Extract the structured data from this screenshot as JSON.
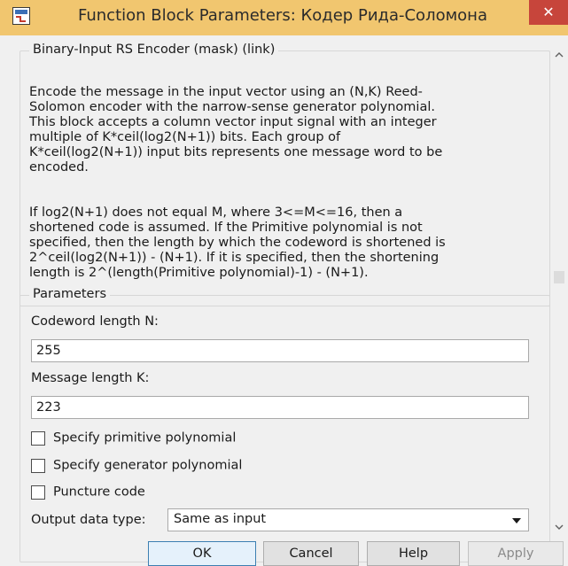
{
  "window": {
    "title": "Function Block Parameters: Кодер Рида-Соломона",
    "close_label": "✕",
    "titlebar_color": "#f1c66f",
    "close_color": "#c7453b",
    "app_icon": "simulink-block-icon"
  },
  "mask": {
    "legend": "Binary-Input RS Encoder (mask) (link)",
    "paragraphs": [
      "Encode the message in the input vector using an (N,K) Reed-\nSolomon encoder with the narrow-sense generator polynomial.\nThis block accepts a column vector input signal with an integer\nmultiple of K*ceil(log2(N+1)) bits.  Each group of\nK*ceil(log2(N+1)) input bits represents one message word to be\nencoded.",
      "If log2(N+1) does not equal M, where 3<=M<=16, then a\nshortened code is assumed.  If the Primitive polynomial is not\nspecified, then the length by which the codeword is shortened is\n2^ceil(log2(N+1)) - (N+1).  If it is specified, then the shortening\nlength is 2^(length(Primitive polynomial)-1) - (N+1)."
    ]
  },
  "parameters": {
    "legend": "Parameters",
    "codeword_label": "Codeword length N:",
    "codeword_value": "255",
    "message_label": "Message length K:",
    "message_value": "223",
    "checkboxes": [
      {
        "label": "Specify primitive polynomial",
        "checked": false
      },
      {
        "label": "Specify generator polynomial",
        "checked": false
      },
      {
        "label": "Puncture code",
        "checked": false
      }
    ],
    "output_type_label": "Output data type:",
    "output_type_value": "Same as input"
  },
  "scrollbar": {
    "up_icon": "scroll-up-arrow",
    "down_icon": "scroll-down-arrow"
  },
  "buttons": {
    "ok": "OK",
    "cancel": "Cancel",
    "help": "Help",
    "apply": "Apply"
  }
}
